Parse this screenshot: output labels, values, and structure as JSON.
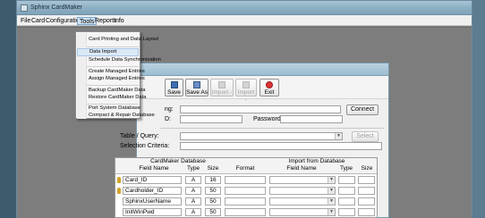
{
  "window": {
    "title": "Sphinx CardMaker"
  },
  "menubar": {
    "items": [
      "File",
      "Card",
      "Configuration",
      "Tools",
      "Reports",
      "Info"
    ]
  },
  "tools_menu": {
    "groups": [
      [
        "Card Printing and Data Layout"
      ],
      [
        "Data Import",
        "Schedule Data Synchronization"
      ],
      [
        "Create Managed Entries",
        "Assign Managed Entries"
      ],
      [
        "Backup CardMaker Data",
        "Restore CardMaker Data"
      ],
      [
        "Port System Database",
        "Compact & Repair Database"
      ]
    ],
    "highlighted": "Data Import"
  },
  "toolbar": {
    "save": "Save",
    "save_as": "Save As",
    "import_partial1": "Import -",
    "import_partial2": "Import -",
    "exit": "Exit"
  },
  "form": {
    "connection_label_tail": "ng:",
    "user_label_tail": "D:",
    "password_label": "Password:",
    "connect_button": "Connect",
    "table_query_label": "Table / Query:",
    "select_button": "Select",
    "selection_criteria_label": "Selection Criteria:"
  },
  "grid": {
    "group_left": "CardMaker Database",
    "group_right": "Import from Database",
    "columns": [
      "Field Name",
      "Type",
      "Size",
      "Format",
      "Field Name",
      "Type",
      "Size"
    ],
    "rows": [
      {
        "field": "Card_ID",
        "type": "A",
        "size": "16",
        "key": true
      },
      {
        "field": "Cardholder_ID",
        "type": "A",
        "size": "50",
        "key": true
      },
      {
        "field": "SphinxUserName",
        "type": "A",
        "size": "50",
        "key": false
      },
      {
        "field": "InitWinPwd",
        "type": "A",
        "size": "50",
        "key": false
      }
    ]
  },
  "colors": {
    "titlebar": "#8eb0c4",
    "menu_highlight": "#dbe9f7",
    "workspace": "#7d7d7d"
  }
}
